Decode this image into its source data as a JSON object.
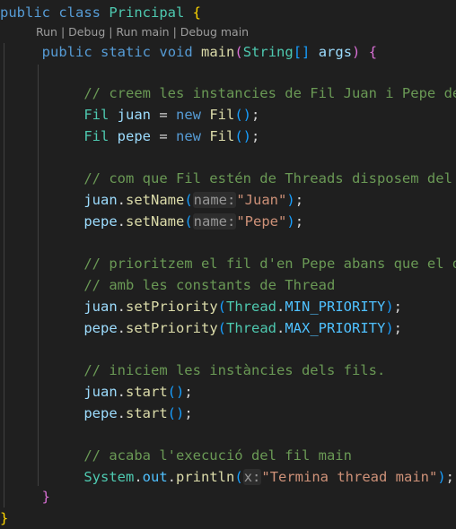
{
  "code_lens": {
    "run": "Run",
    "debug": "Debug",
    "run_main": "Run main",
    "debug_main": "Debug main",
    "sep": " | "
  },
  "lines": {
    "l1": {
      "kw": "public class",
      "name": "Principal",
      "brace": "{"
    },
    "l2": {
      "kw1": "public",
      "kw2": "static",
      "kw3": "void",
      "fn": "main",
      "type": "String",
      "param": "args",
      "brace": "{"
    },
    "c1": "// creem les instancies de Fil Juan i Pepe de",
    "l4": {
      "type": "Fil",
      "var": "juan",
      "new": "new",
      "cls": "Fil"
    },
    "l5": {
      "type": "Fil",
      "var": "pepe",
      "new": "new",
      "cls": "Fil"
    },
    "c2": "// com que Fil estén de Threads disposem del",
    "l7": {
      "obj": "juan",
      "fn": "setName",
      "hint": "name:",
      "str": "\"Juan\""
    },
    "l8": {
      "obj": "pepe",
      "fn": "setName",
      "hint": "name:",
      "str": "\"Pepe\""
    },
    "c3": "// prioritzem el fil d'en Pepe abans que el d",
    "c4": "// amb les constants de Thread",
    "l11": {
      "obj": "juan",
      "fn": "setPriority",
      "cls": "Thread",
      "const": "MIN_PRIORITY"
    },
    "l12": {
      "obj": "pepe",
      "fn": "setPriority",
      "cls": "Thread",
      "const": "MAX_PRIORITY"
    },
    "c5": "// iniciem les instàncies dels fils.",
    "l14": {
      "obj": "juan",
      "fn": "start"
    },
    "l15": {
      "obj": "pepe",
      "fn": "start"
    },
    "c6": "// acaba l'execució del fil main",
    "l17": {
      "cls": "System",
      "field": "out",
      "fn": "println",
      "hint": "x:",
      "str": "\"Termina thread main\""
    },
    "close_inner": "}",
    "close_outer": "}"
  }
}
